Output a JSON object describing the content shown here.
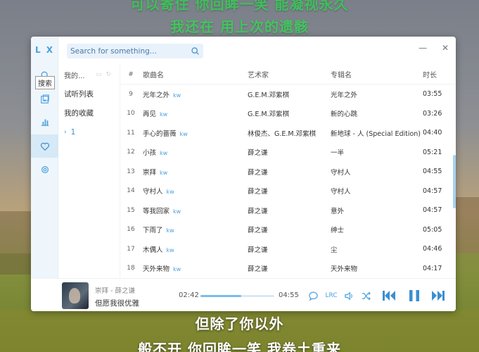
{
  "lyrics": {
    "top_line_1": "可以寄住 你回眸一笑 能凝视永久",
    "top_line_2": "我还在 用上次的遗骸",
    "bottom_line_1": "但除了你以外",
    "bottom_line_2": "般不开 你回眸一笑 我卷土重来"
  },
  "app": {
    "logo": "L X",
    "tooltip": "搜索"
  },
  "search": {
    "placeholder": "Search for something..."
  },
  "window": {
    "minimize": "—",
    "close": "✕"
  },
  "lists": {
    "header": "我的...",
    "items": [
      {
        "label": "试听列表"
      },
      {
        "label": "我的收藏"
      },
      {
        "label": "1",
        "chevron": "›"
      }
    ]
  },
  "table": {
    "headers": {
      "num": "#",
      "name": "歌曲名",
      "artist": "艺术家",
      "album": "专辑名",
      "duration": "时长"
    },
    "source_tag": "kw",
    "rows": [
      {
        "num": "9",
        "name": "光年之外",
        "artist": "G.E.M.邓紫棋",
        "album": "光年之外",
        "duration": "03:55"
      },
      {
        "num": "10",
        "name": "再见",
        "artist": "G.E.M.邓紫棋",
        "album": "新的心跳",
        "duration": "03:26"
      },
      {
        "num": "11",
        "name": "手心的蔷薇",
        "artist": "林俊杰、G.E.M.邓紫棋",
        "album": "新地球 - 人 (Special Edition)",
        "duration": "04:40"
      },
      {
        "num": "12",
        "name": "小孩",
        "artist": "薛之谦",
        "album": "一半",
        "duration": "05:21"
      },
      {
        "num": "13",
        "name": "崇拜",
        "artist": "薛之谦",
        "album": "守村人",
        "duration": "04:55"
      },
      {
        "num": "14",
        "name": "守村人",
        "artist": "薛之谦",
        "album": "守村人",
        "duration": "04:57"
      },
      {
        "num": "15",
        "name": "等我回家",
        "artist": "薛之谦",
        "album": "意外",
        "duration": "04:57"
      },
      {
        "num": "16",
        "name": "下雨了",
        "artist": "薛之谦",
        "album": "绅士",
        "duration": "05:05"
      },
      {
        "num": "17",
        "name": "木偶人",
        "artist": "薛之谦",
        "album": "尘",
        "duration": "04:46"
      },
      {
        "num": "18",
        "name": "天外来物",
        "artist": "薛之谦",
        "album": "天外来物",
        "duration": "04:17"
      }
    ]
  },
  "player": {
    "song": "崇拜 - 薛之谦",
    "lyric": "但愿我很优雅",
    "current_time": "02:42",
    "total_time": "04:55",
    "progress": 0.55,
    "lrc_label": "LRC"
  },
  "colors": {
    "accent": "#4aa0e0",
    "lyric_green": "#43c45e"
  }
}
